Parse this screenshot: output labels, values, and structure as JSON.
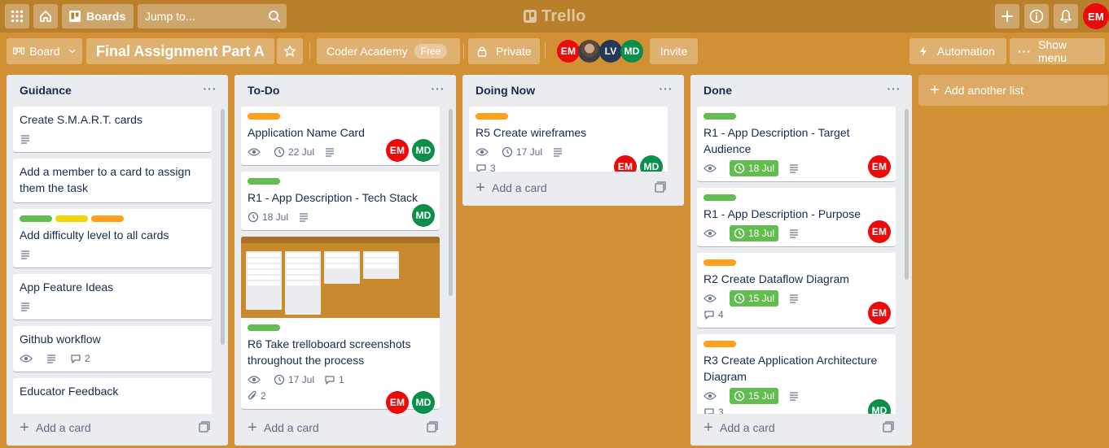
{
  "header": {
    "boards_label": "Boards",
    "search_placeholder": "Jump to...",
    "logo_text": "Trello",
    "user_initials": "EM"
  },
  "board": {
    "view_label": "Board",
    "title": "Final Assignment Part A",
    "workspace": "Coder Academy",
    "workspace_plan": "Free",
    "visibility": "Private",
    "members": [
      "EM",
      "LV",
      "MD"
    ],
    "invite_label": "Invite",
    "automation_label": "Automation",
    "show_menu_label": "Show menu"
  },
  "colors": {
    "background": "#d29034",
    "green_label": "#61bd4f",
    "yellow_label": "#f2d600",
    "orange_label": "#ff9f1a",
    "em_avatar": "#eb0b0b",
    "md_avatar": "#0b8f4a",
    "lv_avatar": "#253858"
  },
  "add_card_label": "Add a card",
  "add_list_label": "Add another list",
  "lists": [
    {
      "title": "Guidance",
      "cards": [
        {
          "title": "Create S.M.A.R.T. cards"
        },
        {
          "title": "Add a member to a card to assign them the task"
        },
        {
          "title": "Add difficulty level to all cards",
          "labels": [
            "green",
            "yellow",
            "orange"
          ]
        },
        {
          "title": "App Feature Ideas"
        },
        {
          "title": "Github workflow",
          "comments": "2"
        },
        {
          "title": "Educator Feedback"
        }
      ]
    },
    {
      "title": "To-Do",
      "cards": [
        {
          "title": "Application Name Card",
          "date": "22 Jul",
          "members": [
            "EM",
            "MD"
          ],
          "labels": [
            "orange"
          ]
        },
        {
          "title": "R1 - App Description - Tech Stack",
          "date": "18 Jul",
          "members": [
            "MD"
          ],
          "labels": [
            "green"
          ]
        },
        {
          "title": "R6 Take trelloboard screenshots throughout the process",
          "date": "17 Jul",
          "comments": "1",
          "attachments": "2",
          "members": [
            "EM",
            "MD"
          ],
          "labels": [
            "green"
          ]
        }
      ]
    },
    {
      "title": "Doing Now",
      "cards": [
        {
          "title": "R5 Create wireframes",
          "date": "17 Jul",
          "comments": "3",
          "members": [
            "EM",
            "MD"
          ],
          "labels": [
            "orange"
          ]
        }
      ]
    },
    {
      "title": "Done",
      "cards": [
        {
          "title": "R1 - App Description - Target Audience",
          "date": "18 Jul",
          "members": [
            "EM"
          ],
          "labels": [
            "green"
          ]
        },
        {
          "title": "R1 - App Description - Purpose",
          "date": "18 Jul",
          "members": [
            "EM"
          ],
          "labels": [
            "green"
          ]
        },
        {
          "title": "R2 Create Dataflow Diagram",
          "date": "15 Jul",
          "comments": "4",
          "members": [
            "EM"
          ],
          "labels": [
            "orange"
          ]
        },
        {
          "title": "R3 Create Application Architecture Diagram",
          "date": "15 Jul",
          "comments": "3",
          "members": [
            "MD"
          ],
          "labels": [
            "orange"
          ]
        }
      ]
    }
  ]
}
